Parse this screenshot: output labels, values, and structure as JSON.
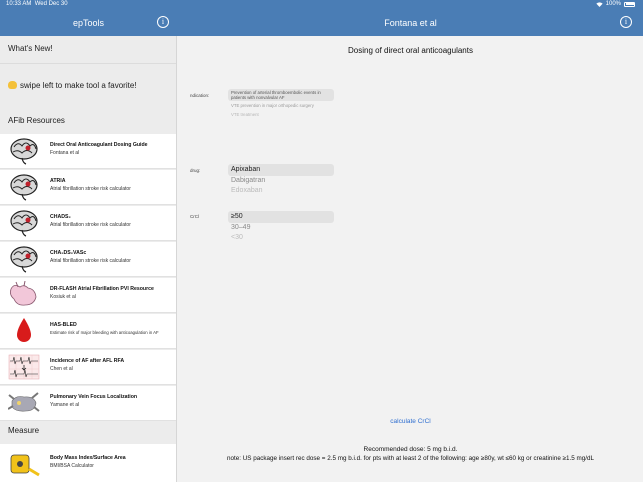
{
  "status": {
    "time": "10:33 AM",
    "date": "Wed Dec 30",
    "battery": "100%"
  },
  "nav": {
    "left_title": "epTools",
    "right_title": "Fontana et al",
    "info_glyph": "i"
  },
  "sidebar": {
    "whats_new": "What's New!",
    "tip": "swipe left to make tool a favorite!",
    "afib_header": "AFib Resources",
    "items": [
      {
        "title": "Direct Oral Anticoagulant Dosing Guide",
        "subtitle": "Fontana et al",
        "icon": "brain-icon"
      },
      {
        "title": "ATRIA",
        "subtitle": "Atrial fibrillation stroke risk calculator",
        "icon": "brain-icon"
      },
      {
        "title": "CHADS₂",
        "subtitle": "Atrial fibrillation stroke risk calculator",
        "icon": "brain-icon"
      },
      {
        "title": "CHA₂DS₂VASc",
        "subtitle": "Atrial fibrillation stroke risk calculator",
        "icon": "brain-icon"
      },
      {
        "title": "DR-FLASH  Atrial Fibrillation PVI Resource",
        "subtitle": "Kosiuk et al",
        "icon": "atrium-icon"
      },
      {
        "title": "HAS-BLED",
        "subtitle": "Estimate risk of major bleeding with anticoagulation in AF",
        "icon": "blood-drop-icon"
      },
      {
        "title": "Incidence of AF after AFL RFA",
        "subtitle": "Chen et al",
        "icon": "ecg-icon"
      },
      {
        "title": "Pulmonary Vein Focus Localization",
        "subtitle": "Yamane et al",
        "icon": "pulmonary-vein-icon"
      }
    ],
    "measure_header": "Measure",
    "measure_items": [
      {
        "title": "Body Mass Index/Surface Area",
        "subtitle": "BMI/BSA Calculator",
        "icon": "tape-measure-icon"
      }
    ]
  },
  "detail": {
    "title": "Dosing of direct oral anticoagulants",
    "indication_label": "ndication:",
    "indication_options": [
      "Prevention of arterial thromboembolic events in patients with nonvalvular AF",
      "VTE prevention in major orthopedic surgery",
      "VTE treatment"
    ],
    "drug_label": "drug:",
    "drug_options": [
      "Apixaban",
      "Dabigatran",
      "Edoxaban"
    ],
    "crcl_label": "CrCl",
    "crcl_options": [
      "≥50",
      "30–49",
      "<30"
    ],
    "calc_link": "calculate CrCl",
    "recommended": "Recommended dose: 5 mg b.i.d.",
    "note": "note: US package insert rec dose = 2.5 mg b.i.d. for pts with at least 2 of the following: age ≥80y, wt ≤60 kg or creatinine ≥1.5 mg/dL"
  }
}
